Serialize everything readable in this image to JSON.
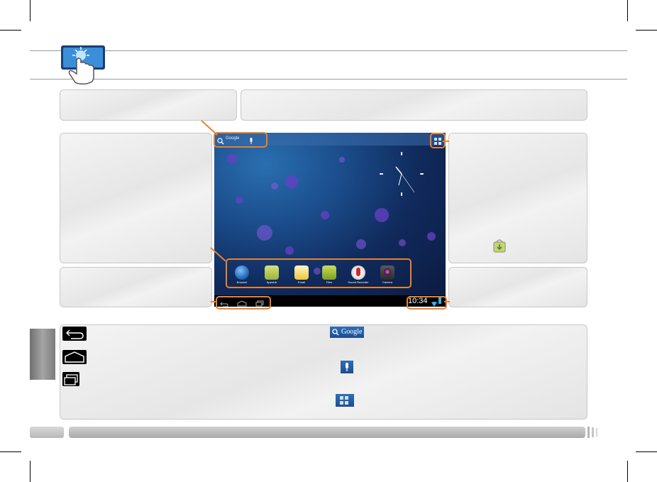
{
  "colors": {
    "accent": "#e8822d",
    "panel": "#eaeaea",
    "screen_bg": "#102a5c",
    "tab_bg": "#8c8c8c"
  },
  "screen": {
    "search_label": "Google",
    "time": "10:34",
    "dock_labels": [
      "Browser",
      "AppsLib",
      "Email",
      "Files",
      "Sound Recorder",
      "Camera"
    ]
  },
  "legend": {
    "google_button": "Google"
  },
  "icons": {
    "header": "touch-hand-icon",
    "back": "back-arrow-icon",
    "home": "home-icon",
    "recent": "recent-apps-icon",
    "search": "search-icon",
    "mic": "microphone-icon",
    "apps": "all-apps-grid-icon",
    "store": "app-store-bag-icon"
  }
}
